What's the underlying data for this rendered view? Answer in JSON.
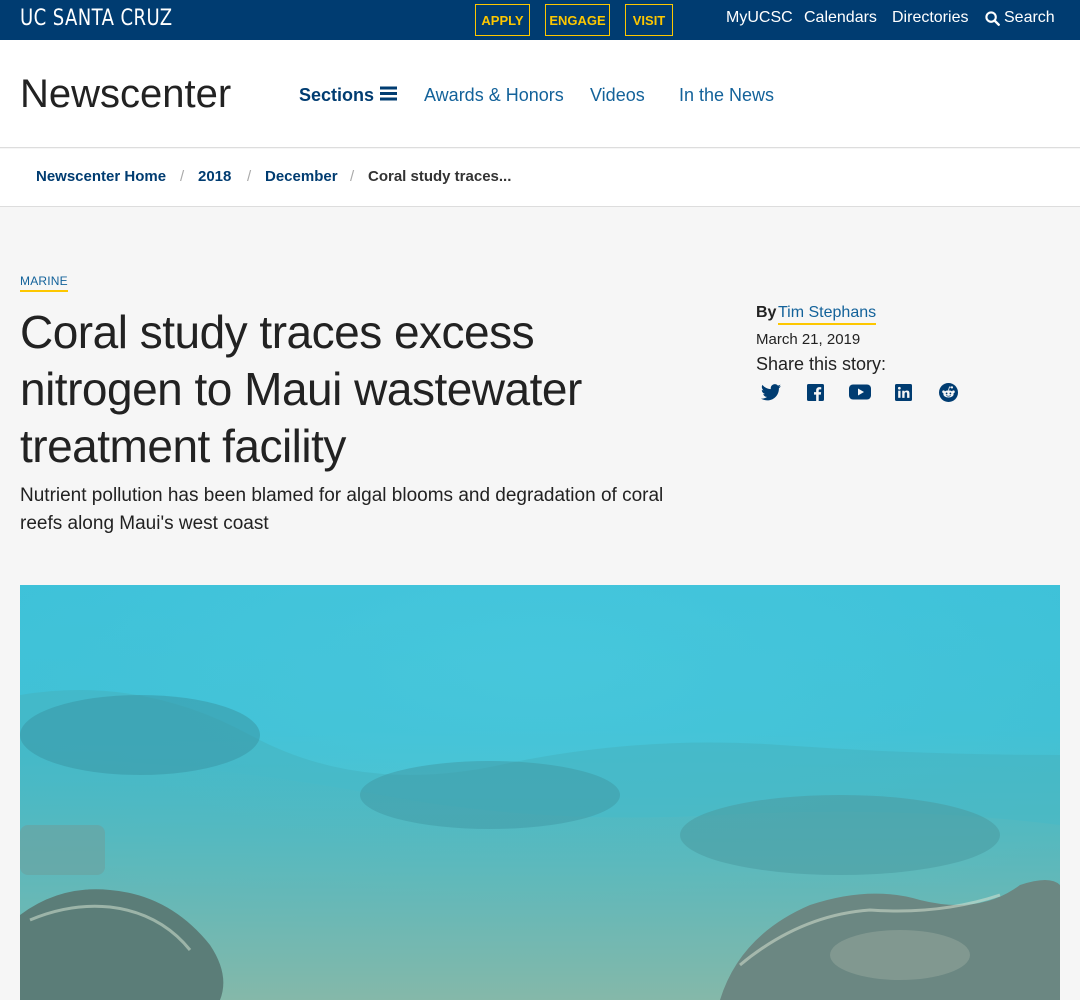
{
  "topbar": {
    "logo": "UC SANTA CRUZ",
    "cta": {
      "apply": "APPLY",
      "engage": "ENGAGE",
      "visit": "VISIT"
    },
    "links": {
      "myucsc": "MyUCSC",
      "calendars": "Calendars",
      "directories": "Directories",
      "search": "Search"
    }
  },
  "header": {
    "site_title": "Newscenter",
    "nav": {
      "sections": "Sections",
      "awards": "Awards & Honors",
      "videos": "Videos",
      "news": "In the News"
    }
  },
  "breadcrumb": {
    "home": "Newscenter Home",
    "year": "2018",
    "month": "December",
    "current": "Coral study traces...",
    "separator": "/"
  },
  "article": {
    "category": "MARINE",
    "headline": "Coral study traces excess nitrogen to Maui wastewater treatment facility",
    "subhead": "Nutrient pollution has been blamed for algal blooms and degradation of coral reefs along Maui's west coast",
    "byline_prefix": "By",
    "author": "Tim Stephans",
    "date": "March 21, 2019",
    "share_label": "Share this story:",
    "share_icons": [
      "twitter-icon",
      "facebook-icon",
      "youtube-icon",
      "linkedin-icon",
      "reddit-icon"
    ]
  },
  "colors": {
    "navy": "#003c71",
    "gold": "#fdc700",
    "link_blue": "#13629a",
    "page_bg": "#f6f6f6"
  }
}
